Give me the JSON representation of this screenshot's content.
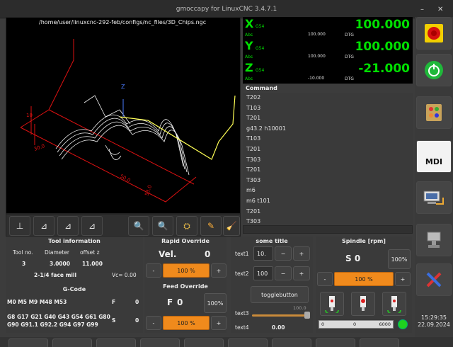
{
  "window": {
    "title": "gmoccapy for LinuxCNC  3.4.7.1",
    "min": "–",
    "close": "✕"
  },
  "gremlin": {
    "file_path": "/home/user/linuxcnc-292-feb/configs/nc_files/3D_Chips.ngc",
    "axis_label_z": "Z",
    "dims": [
      "30.0",
      "10",
      "50.0",
      "53.0",
      "10.0",
      "50.0"
    ],
    "toolbar": [
      "view-p",
      "view-x",
      "view-y",
      "view-z",
      "zoom-in",
      "zoom-out",
      "clear",
      "edit",
      "broom"
    ]
  },
  "dro": {
    "rows": [
      {
        "axis": "X",
        "sys": "G54",
        "abs_label": "Abs",
        "abs": "100.000",
        "dtg_label": "DTG",
        "value": "100.000"
      },
      {
        "axis": "Y",
        "sys": "G54",
        "abs_label": "Abs",
        "abs": "100.000",
        "dtg_label": "DTG",
        "value": "100.000"
      },
      {
        "axis": "Z",
        "sys": "G54",
        "abs_label": "Abs",
        "abs": "-10.000",
        "dtg_label": "DTG",
        "value": "-21.000"
      }
    ]
  },
  "command": {
    "header": "Command",
    "items": [
      "T202",
      "T103",
      "T201",
      "g43.2 h10001",
      "T103",
      "T201",
      "T303",
      "T201",
      "T303",
      "m6",
      "m6 t101",
      "T201",
      "T303"
    ]
  },
  "sidebar": {
    "buttons": [
      "estop-icon",
      "power-on-icon",
      "manual-icon",
      "mdi",
      "auto-icon",
      "settings-icon",
      "tools-icon"
    ],
    "mdi_label": "MDI",
    "time": "15:29:35",
    "date": "22.09.2024"
  },
  "tool_info": {
    "header": "Tool information",
    "col_tool": "Tool no.",
    "col_diam": "Diameter",
    "col_offset": "offset z",
    "tool": "3",
    "diameter": "3.0000",
    "offset": "11.000",
    "desc": "2-1/4 face mill",
    "vc": "Vc= 0.00"
  },
  "gcode": {
    "header": "G-Code",
    "mcodes": "M0 M5 M9 M48 M53",
    "f_label": "F",
    "f_val": "0",
    "gcodes_1": "G8 G17 G21 G40 G43 G54 G61 G80",
    "gcodes_2": "G90 G91.1 G92.2 G94 G97 G99",
    "s_label": "S",
    "s_val": "0"
  },
  "rapid": {
    "header": "Rapid Override",
    "vel_label": "Vel.",
    "vel": "0",
    "minus": "-",
    "plus": "+",
    "pct": "100 %",
    "pct_value": 100
  },
  "feed": {
    "header": "Feed Override",
    "f_label": "F",
    "f": "0",
    "reset": "100%",
    "minus": "-",
    "plus": "+",
    "pct": "100 %",
    "pct_value": 100
  },
  "user": {
    "header": "some title",
    "text1_label": "text1",
    "text1_val": "10.",
    "text2_label": "text2",
    "text2_val": "100",
    "minus": "−",
    "plus": "+",
    "toggle": "togglebutton",
    "text3_label": "text3",
    "text3_val": "100.0",
    "text4_label": "text4",
    "text4_val": "0.00"
  },
  "spindle": {
    "header": "Spindle [rpm]",
    "s": "S 0",
    "reset": "100%",
    "minus": "-",
    "plus": "+",
    "pct": "100 %",
    "pct_value": 100,
    "scale_min": "0",
    "scale_mid": "0",
    "scale_max": "6000"
  }
}
